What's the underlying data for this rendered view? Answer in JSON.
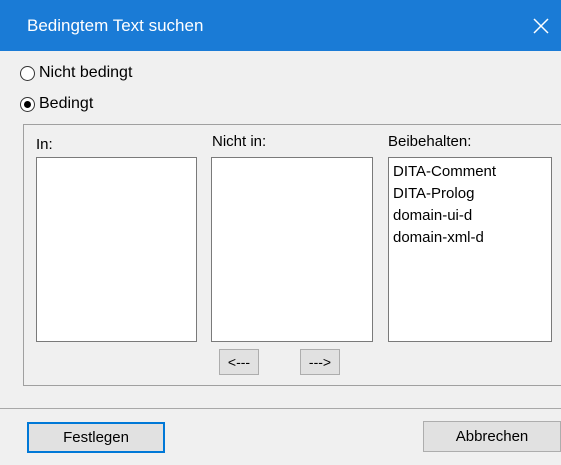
{
  "window": {
    "title": "Bedingtem Text suchen"
  },
  "options": {
    "not_conditional": "Nicht bedingt",
    "conditional": "Bedingt"
  },
  "columns": {
    "in": {
      "label": "In:",
      "items": []
    },
    "not_in": {
      "label": "Nicht in:",
      "items": []
    },
    "keep": {
      "label": "Beibehalten:",
      "items": [
        "DITA-Comment",
        "DITA-Prolog",
        "domain-ui-d",
        "domain-xml-d"
      ]
    }
  },
  "move_buttons": {
    "left": "<---",
    "right": "--->"
  },
  "footer": {
    "set_label": "Festlegen",
    "cancel_label": "Abbrechen"
  }
}
